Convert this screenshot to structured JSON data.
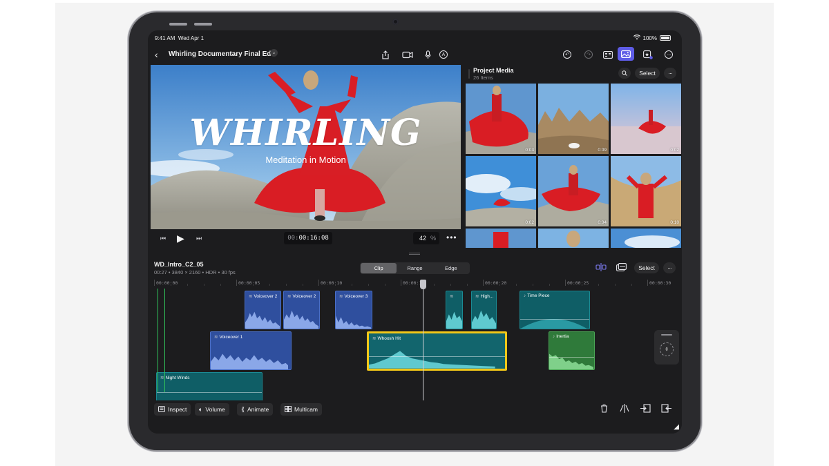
{
  "status_bar": {
    "time": "9:41 AM",
    "date": "Wed Apr 1",
    "battery": "100%"
  },
  "toolbar": {
    "title": "Whirling Documentary Final Edit",
    "icons": [
      "share-icon",
      "camera-icon",
      "microphone-icon",
      "pencil-icon",
      "undo-icon",
      "redo-icon",
      "inspector-icon",
      "photos-icon",
      "effects-icon",
      "more-icon"
    ]
  },
  "viewer": {
    "title_card": "WHIRLING",
    "subtitle": "Meditation in Motion",
    "timecode_dim": "00:",
    "timecode_bright": "00:16:08",
    "zoom": "42",
    "zoom_unit": "%"
  },
  "browser": {
    "title": "Project Media",
    "count": "26 Items",
    "select_label": "Select",
    "thumbnails": [
      {
        "duration": "0:03"
      },
      {
        "duration": "0:09"
      },
      {
        "duration": "0:02"
      },
      {
        "duration": "0:02"
      },
      {
        "duration": "0:04"
      },
      {
        "duration": "0:10"
      },
      {
        "duration": ""
      },
      {
        "duration": ""
      },
      {
        "duration": ""
      }
    ]
  },
  "timeline": {
    "clip_name": "WD_Intro_C2_05",
    "clip_meta": "00:27 • 3840 × 2160 • HDR • 30 fps",
    "modes": [
      "Clip",
      "Range",
      "Edge"
    ],
    "active_mode": "Clip",
    "select_label": "Select",
    "ruler": [
      "00:00:00",
      "00:00:05",
      "00:00:10",
      "00:00:15",
      "00:00:20",
      "00:00:25",
      "00:00:30"
    ],
    "clips": [
      {
        "label": "Voiceover 2",
        "type": "blue"
      },
      {
        "label": "Voiceover 2",
        "type": "blue"
      },
      {
        "label": "Voiceover 3",
        "type": "blue"
      },
      {
        "label": "",
        "type": "teal"
      },
      {
        "label": "High...",
        "type": "teal"
      },
      {
        "label": "Time Piece",
        "type": "teal"
      },
      {
        "label": "Voiceover 1",
        "type": "blue"
      },
      {
        "label": "Whoosh Hit",
        "type": "selected"
      },
      {
        "label": "Inertia",
        "type": "green"
      },
      {
        "label": "Night Winds",
        "type": "teal"
      }
    ]
  },
  "bottom_bar": {
    "inspect": "Inspect",
    "volume": "Volume",
    "animate": "Animate",
    "multicam": "Multicam"
  },
  "colors": {
    "accent": "#5e5ce6",
    "selection": "#f2c718",
    "clip_blue": "#2f4f9e",
    "clip_teal": "#0f5e66",
    "clip_green": "#2f7a3a"
  }
}
